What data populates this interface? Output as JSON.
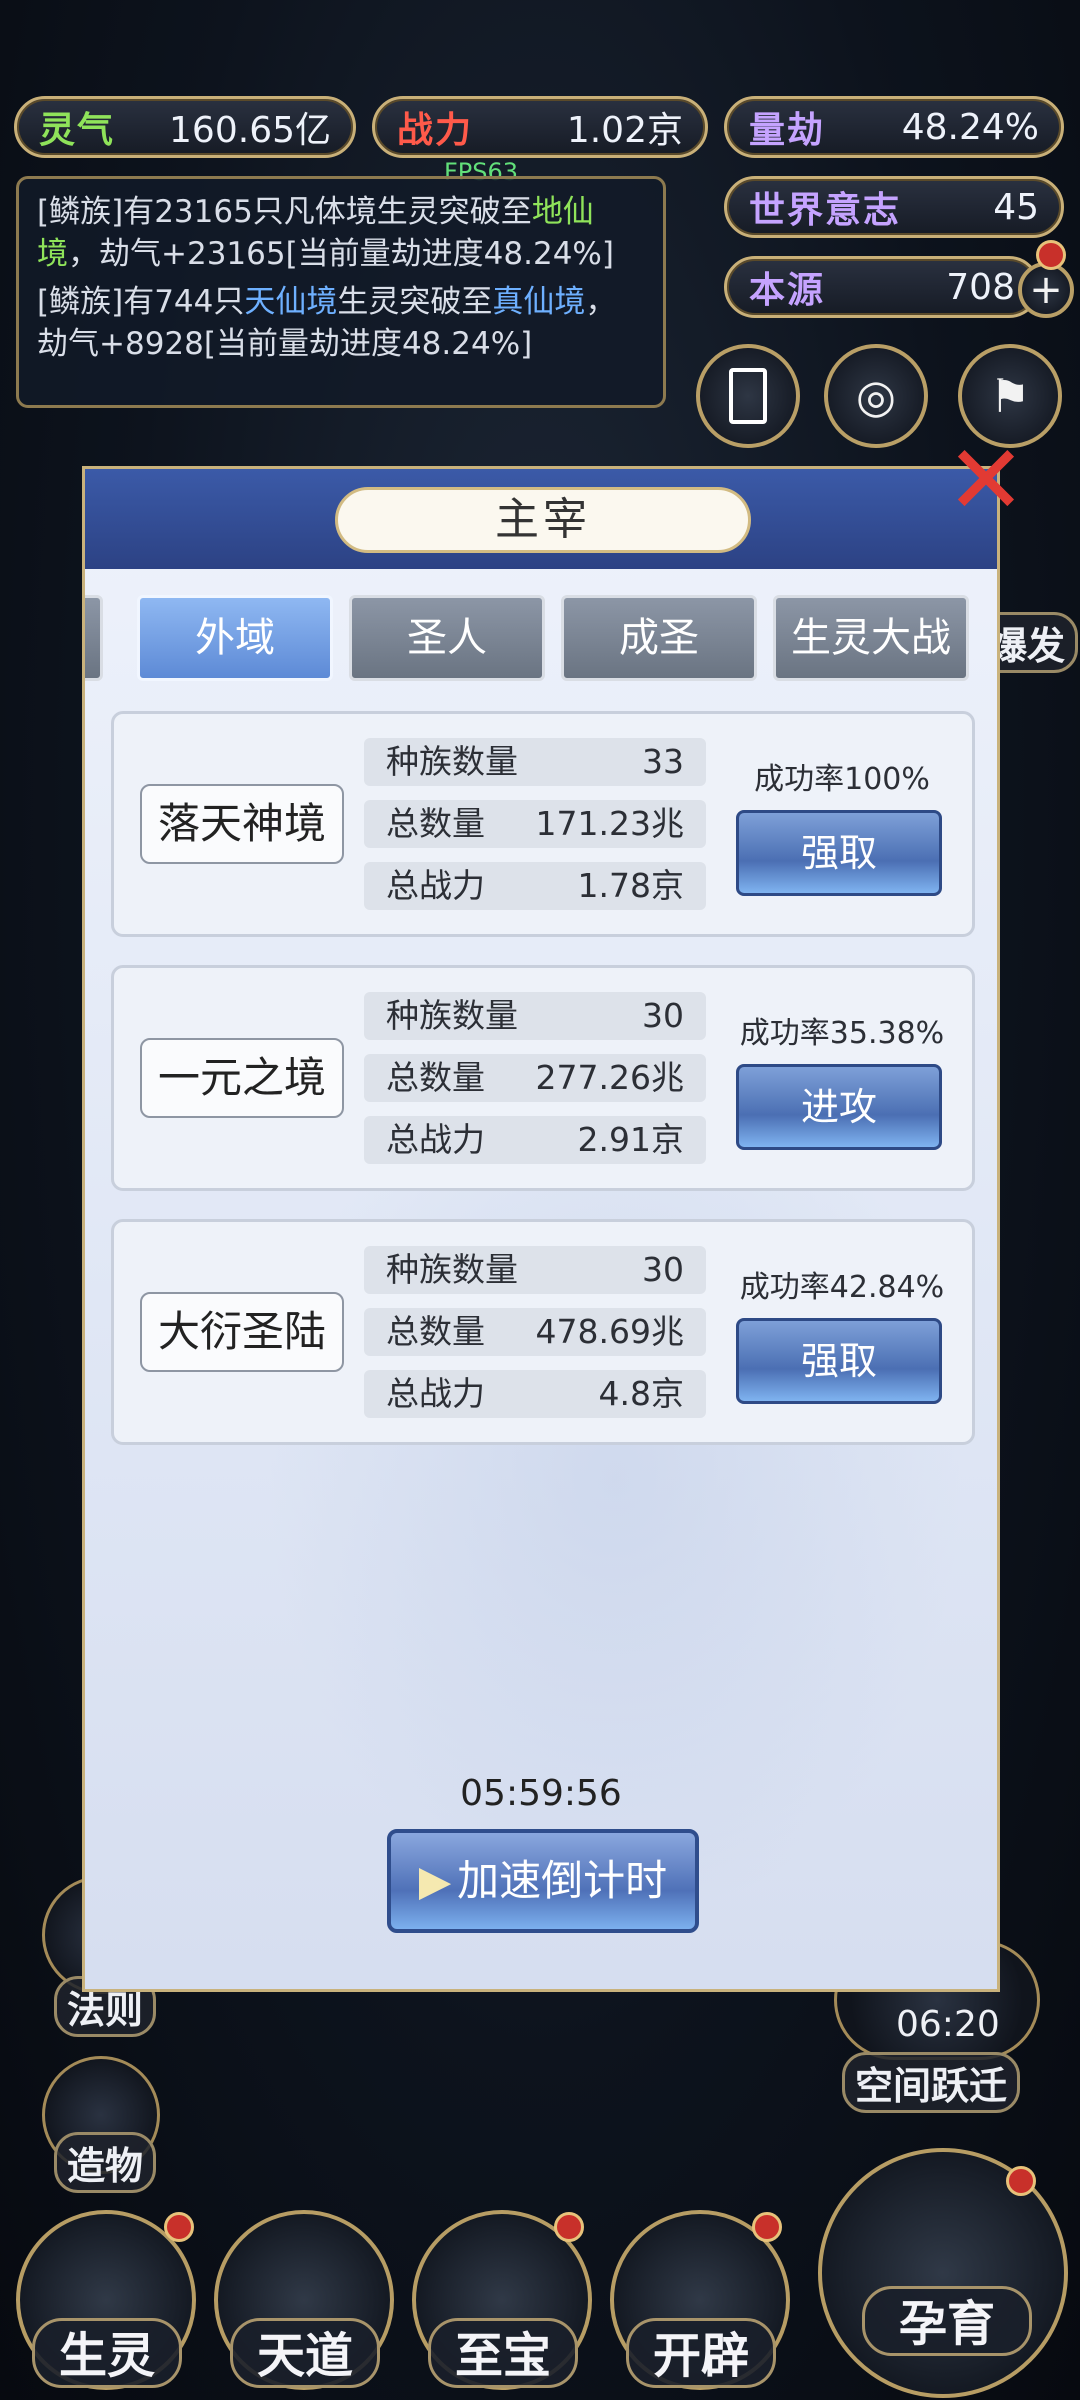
{
  "top_stats": {
    "lingqi": {
      "label": "灵气",
      "value": "160.65亿"
    },
    "zhanli": {
      "label": "战力",
      "value": "1.02京"
    },
    "liangjie": {
      "label": "量劫",
      "value": "48.24%"
    },
    "shijie_yizhi": {
      "label": "世界意志",
      "value": "45"
    },
    "benyuan": {
      "label": "本源",
      "value": "708"
    }
  },
  "fps": "FPS63",
  "log": [
    {
      "prefix": "[鳞族]有23165只凡体境生灵突破至",
      "highlight": "地仙境",
      "suffix": "，劫气+23165[当前量劫进度48.24%]"
    },
    {
      "prefix": "[鳞族]有744只",
      "highlight": "天仙境",
      "middle": "生灵突破至",
      "highlight2": "真仙境",
      "suffix": "，劫气+8928[当前量劫进度48.24%]"
    }
  ],
  "dialog": {
    "title": "主宰",
    "tabs": [
      "外域",
      "圣人",
      "成圣",
      "生灵大战"
    ],
    "cards": [
      {
        "name": "落天神境",
        "rows": [
          {
            "k": "种族数量",
            "v": "33"
          },
          {
            "k": "总数量",
            "v": "171.23兆"
          },
          {
            "k": "总战力",
            "v": "1.78京"
          }
        ],
        "rate": "成功率100%",
        "action": "强取"
      },
      {
        "name": "一元之境",
        "rows": [
          {
            "k": "种族数量",
            "v": "30"
          },
          {
            "k": "总数量",
            "v": "277.26兆"
          },
          {
            "k": "总战力",
            "v": "2.91京"
          }
        ],
        "rate": "成功率35.38%",
        "action": "进攻"
      },
      {
        "name": "大衍圣陆",
        "rows": [
          {
            "k": "种族数量",
            "v": "30"
          },
          {
            "k": "总数量",
            "v": "478.69兆"
          },
          {
            "k": "总战力",
            "v": "4.8京"
          }
        ],
        "rate": "成功率42.84%",
        "action": "强取"
      }
    ],
    "timer": "05:59:56",
    "speed_button": "加速倒计时"
  },
  "side_labels": {
    "fazhe": "法则",
    "zaowu": "造物",
    "kongjian_timer": "06:20",
    "kongjian": "空间跃迁",
    "baofa": "爆发"
  },
  "bottom_nav": [
    "生灵",
    "天道",
    "至宝",
    "开辟",
    "孕育"
  ],
  "colors": {
    "gold_border": "#c9b078",
    "accent_blue": "#4b6fb3",
    "red_dot": "#c8302a"
  }
}
